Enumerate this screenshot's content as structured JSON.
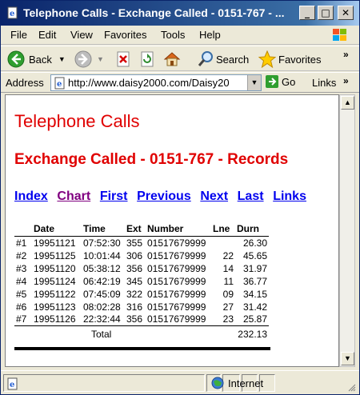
{
  "window": {
    "title": "Telephone Calls - Exchange Called - 0151-767 - ...",
    "minimize": "_",
    "maximize": "□",
    "close": "✕"
  },
  "menu": {
    "items": [
      {
        "label": "File"
      },
      {
        "label": "Edit"
      },
      {
        "label": "View"
      },
      {
        "label": "Favorites"
      },
      {
        "label": "Tools"
      },
      {
        "label": "Help"
      }
    ]
  },
  "toolbar": {
    "back_label": "Back",
    "search_label": "Search",
    "favorites_label": "Favorites",
    "more": "»"
  },
  "addressbar": {
    "label": "Address",
    "url": "http://www.daisy2000.com/Daisy20",
    "go_label": "Go",
    "links_label": "Links",
    "more": "»"
  },
  "page": {
    "title": "Telephone Calls",
    "subtitle": "Exchange Called - 0151-767 - Records",
    "nav": [
      "Index",
      "Chart",
      "First",
      "Previous",
      "Next",
      "Last",
      "Links"
    ],
    "table": {
      "headers": [
        "",
        "Date",
        "Time",
        "Ext",
        "Number",
        "Lne",
        "Durn"
      ],
      "rows": [
        [
          "#1",
          "19951121",
          "07:52:30",
          "355",
          "01517679999",
          "",
          "26.30"
        ],
        [
          "#2",
          "19951125",
          "10:01:44",
          "306",
          "01517679999",
          "22",
          "45.65"
        ],
        [
          "#3",
          "19951120",
          "05:38:12",
          "356",
          "01517679999",
          "14",
          "31.97"
        ],
        [
          "#4",
          "19951124",
          "06:42:19",
          "345",
          "01517679999",
          "11",
          "36.77"
        ],
        [
          "#5",
          "19951122",
          "07:45:09",
          "322",
          "01517679999",
          "09",
          "34.15"
        ],
        [
          "#6",
          "19951123",
          "08:02:28",
          "316",
          "01517679999",
          "27",
          "31.42"
        ],
        [
          "#7",
          "19951126",
          "22:32:44",
          "356",
          "01517679999",
          "23",
          "25.87"
        ]
      ],
      "total_label": "Total",
      "total_value": "232.13"
    }
  },
  "status": {
    "zone": "Internet"
  },
  "colors": {
    "heading": "#e00000",
    "link": "#0000ee",
    "visited_link": "#800080",
    "titlebar": "#0a246a"
  }
}
